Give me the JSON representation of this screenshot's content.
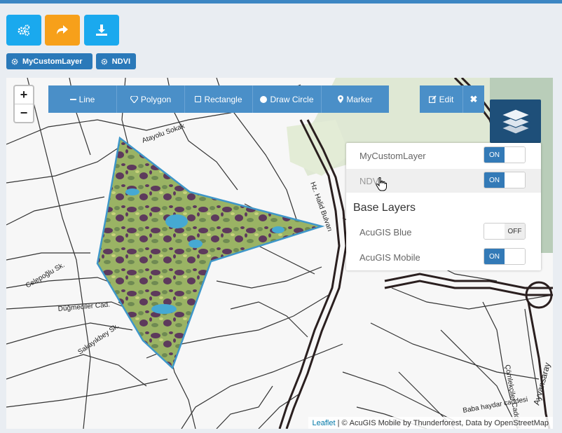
{
  "toolbar": {
    "buttons": [
      {
        "name": "settings-button",
        "icon": "gears-icon",
        "color": "#1aa9ee"
      },
      {
        "name": "share-button",
        "icon": "share-arrow-icon",
        "color": "#f7a01a"
      },
      {
        "name": "download-button",
        "icon": "download-icon",
        "color": "#1aa9ee"
      }
    ]
  },
  "layer_tags": [
    "MyCustomLayer",
    "NDVI"
  ],
  "draw_toolbar": {
    "line": "Line",
    "polygon": "Polygon",
    "rectangle": "Rectangle",
    "circle": "Draw Circle",
    "marker": "Marker",
    "edit": "Edit"
  },
  "zoom": {
    "in": "+",
    "out": "−"
  },
  "layers": {
    "overlays": [
      {
        "name": "MyCustomLayer",
        "state": "ON"
      },
      {
        "name": "NDVI",
        "state": "ON"
      }
    ],
    "base_heading": "Base Layers",
    "base": [
      {
        "name": "AcuGIS Blue",
        "state": "OFF"
      },
      {
        "name": "AcuGIS Mobile",
        "state": "ON"
      }
    ]
  },
  "streets": {
    "s1": "Atayolu Sokak",
    "s2": "Hz. Halid Bulvarı",
    "s3": "Celepoğlu Sk.",
    "s4": "Düğmeciler Cad.",
    "s5": "Sakayıkbey Sk.",
    "s6": "Çömlekçiler Caddesi",
    "s7": "Baba haydar caddesi",
    "s8": "Ayvansaray"
  },
  "attribution": {
    "leaflet": "Leaflet",
    "sep": " | © ",
    "acugis": "AcuGIS Mobile",
    "by": " by ",
    "tf": "Thunderforest",
    "data": ", Data by ",
    "osm": "OpenStreetMap"
  }
}
